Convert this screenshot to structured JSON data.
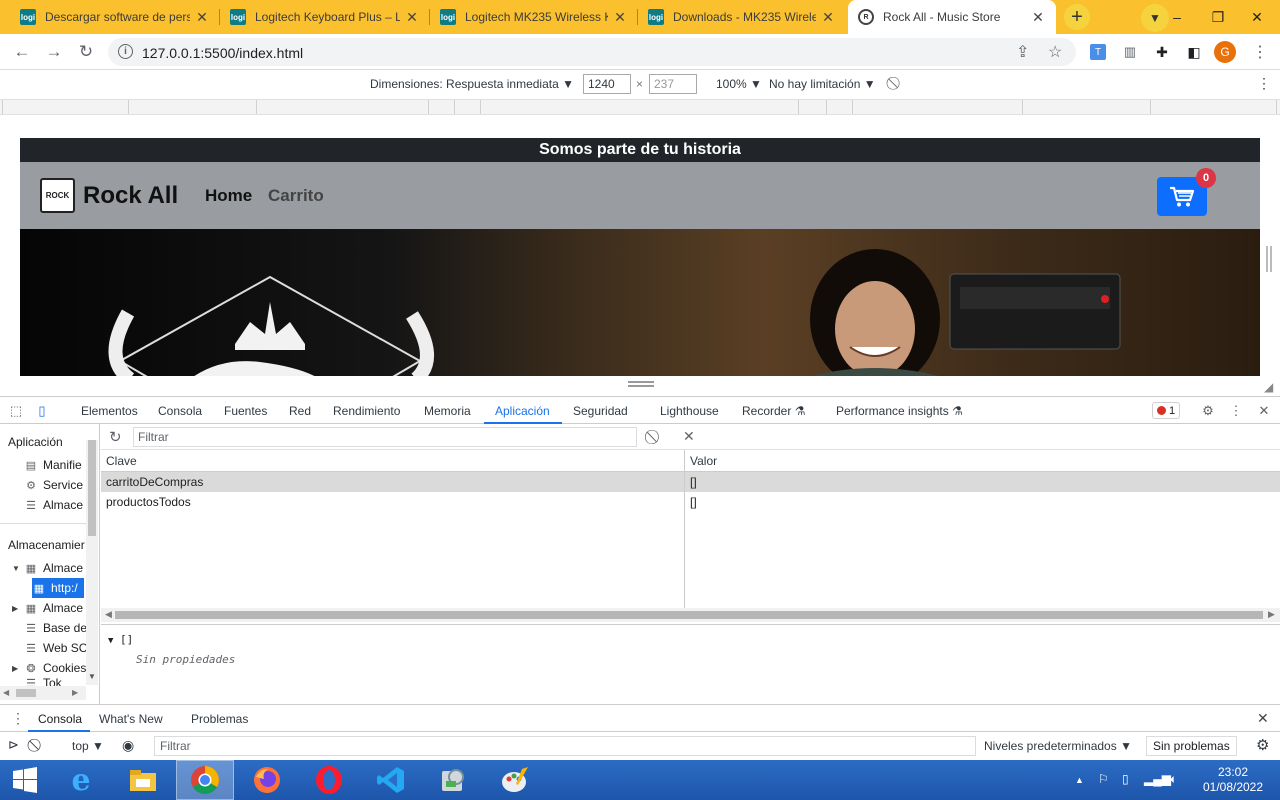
{
  "tabs": [
    {
      "title": "Descargar software de pers",
      "favicon": "logi"
    },
    {
      "title": "Logitech Keyboard Plus – Lo",
      "favicon": "logi"
    },
    {
      "title": "Logitech MK235 Wireless K",
      "favicon": "logi"
    },
    {
      "title": "Downloads - MK235 Wirele",
      "favicon": "logi"
    },
    {
      "title": "Rock All - Music Store",
      "favicon": "rock-all-icon",
      "active": true
    }
  ],
  "omnibox": {
    "url": "127.0.0.1:5500/index.html"
  },
  "extensions": {
    "translate": "T",
    "profile_initial": "G"
  },
  "device_toolbar": {
    "dimensions": "Dimensiones: Respuesta inmediata",
    "width": "1240",
    "times": "×",
    "height_placeholder": "237",
    "zoom": "100%",
    "throttle": "No hay limitación"
  },
  "site": {
    "promo": "Somos parte de tu historia",
    "logo_text": "ROCK",
    "brand": "Rock All",
    "nav": [
      {
        "label": "Home"
      },
      {
        "label": "Carrito"
      }
    ],
    "cart_count": "0"
  },
  "devtools": {
    "tabs": [
      "Elementos",
      "Consola",
      "Fuentes",
      "Red",
      "Rendimiento",
      "Memoria",
      "Aplicación",
      "Seguridad",
      "Lighthouse",
      "Recorder",
      "Performance insights"
    ],
    "error_count": "1",
    "sidebar": {
      "app_heading": "Aplicación",
      "app_items": [
        "Manifie",
        "Service",
        "Almace"
      ],
      "storage_heading": "Almacenamier",
      "storage_items": [
        "Almace",
        "http:/",
        "Almace",
        "Base de",
        "Web SC",
        "Cookies",
        "Tok"
      ]
    },
    "filter_placeholder": "Filtrar",
    "table": {
      "headers": {
        "key": "Clave",
        "value": "Valor"
      },
      "rows": [
        {
          "key": "carritoDeCompras",
          "value": "[]"
        },
        {
          "key": "productosTodos",
          "value": "[]"
        }
      ]
    },
    "preview": {
      "value": "[]",
      "empty": "Sin propiedades"
    }
  },
  "drawer": {
    "tabs": [
      "Consola",
      "What's New",
      "Problemas"
    ],
    "context": "top",
    "filter_placeholder": "Filtrar",
    "levels": "Niveles predeterminados",
    "issues": "Sin problemas"
  },
  "taskbar": {
    "time": "23:02",
    "date": "01/08/2022",
    "apps": [
      "ie-icon",
      "file-explorer-icon",
      "chrome-icon",
      "firefox-icon",
      "opera-icon",
      "vscode-icon",
      "app-icon",
      "paint-icon"
    ]
  }
}
